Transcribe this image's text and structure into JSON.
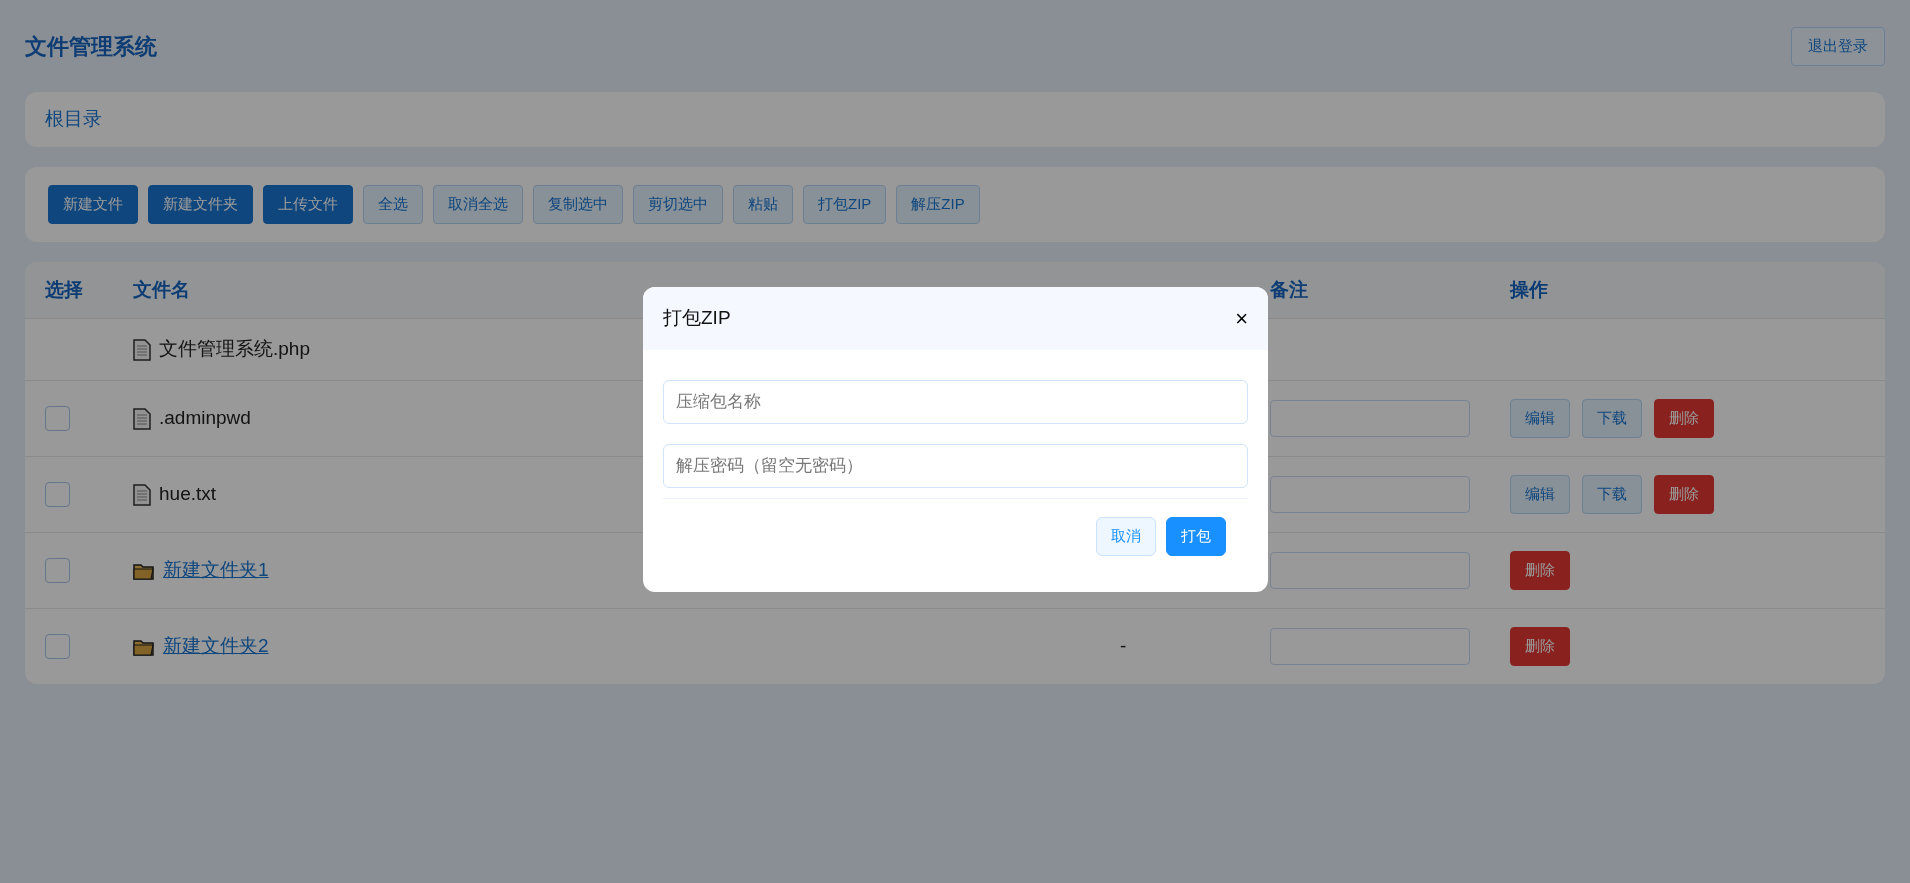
{
  "header": {
    "title": "文件管理系统",
    "logout": "退出登录"
  },
  "breadcrumb": "根目录",
  "toolbar": [
    {
      "label": "新建文件",
      "kind": "primary"
    },
    {
      "label": "新建文件夹",
      "kind": "primary"
    },
    {
      "label": "上传文件",
      "kind": "primary"
    },
    {
      "label": "全选",
      "kind": "outline"
    },
    {
      "label": "取消全选",
      "kind": "outline"
    },
    {
      "label": "复制选中",
      "kind": "outline"
    },
    {
      "label": "剪切选中",
      "kind": "outline"
    },
    {
      "label": "粘贴",
      "kind": "outline"
    },
    {
      "label": "打包ZIP",
      "kind": "outline"
    },
    {
      "label": "解压ZIP",
      "kind": "outline"
    }
  ],
  "table": {
    "columns": [
      {
        "label": "选择",
        "kind": "select"
      },
      {
        "label": "文件名",
        "kind": "name"
      },
      {
        "label": "备注",
        "kind": "note"
      },
      {
        "label": "操作",
        "kind": "actions"
      }
    ],
    "rows": [
      {
        "kind": "file",
        "name": "文件管理系统.php",
        "note_field": false,
        "actions": []
      },
      {
        "kind": "file",
        "name": ".adminpwd",
        "checked": false,
        "note_field": true,
        "actions": [
          {
            "label": "编辑",
            "kind": "default"
          },
          {
            "label": "下载",
            "kind": "default"
          },
          {
            "label": "删除",
            "kind": "danger"
          }
        ]
      },
      {
        "kind": "file",
        "name": "hue.txt",
        "checked": false,
        "note_field": true,
        "actions": [
          {
            "label": "编辑",
            "kind": "default"
          },
          {
            "label": "下载",
            "kind": "default"
          },
          {
            "label": "删除",
            "kind": "danger"
          }
        ]
      },
      {
        "kind": "folder",
        "name": "新建文件夹1",
        "checked": false,
        "note_field": true,
        "actions": [
          {
            "label": "删除",
            "kind": "danger"
          }
        ]
      },
      {
        "kind": "folder",
        "name": "新建文件夹2",
        "checked": false,
        "size": "-",
        "note_field": true,
        "actions": [
          {
            "label": "删除",
            "kind": "danger"
          }
        ]
      }
    ]
  },
  "dialog": {
    "title": "打包ZIP",
    "close": "×",
    "fields": [
      {
        "placeholder": "压缩包名称"
      },
      {
        "placeholder": "解压密码（留空无密码）"
      }
    ],
    "buttons": [
      {
        "label": "取消",
        "kind": "secondary"
      },
      {
        "label": "打包",
        "kind": "primary"
      }
    ]
  }
}
